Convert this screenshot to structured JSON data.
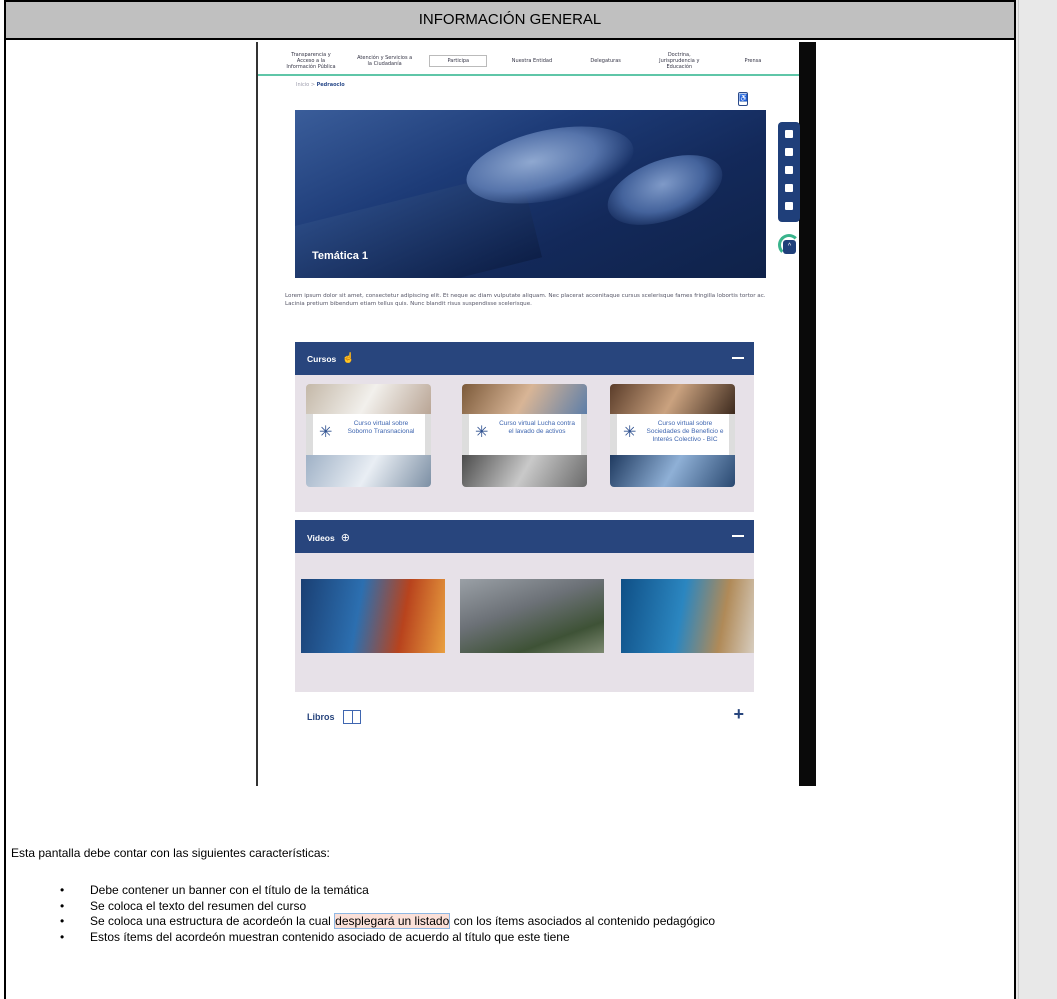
{
  "header": {
    "title": "INFORMACIÓN GENERAL"
  },
  "mockup": {
    "nav": [
      "Transparencia y Acceso a la Información Pública",
      "Atención y Servicios a la Ciudadanía",
      "Participa",
      "Nuestra Entidad",
      "Delegaturas",
      "Doctrina, Jurisprudencia y Educación",
      "Prensa"
    ],
    "breadcrumb": {
      "home": "Inicio",
      "current": "Pedraoclo"
    },
    "banner_title": "Temática 1",
    "summary": "Lorem ipsum dolor sit amet, consectetur adipiscing elit. Et neque ac diam vulputate aliquam. Nec placerat accenitaque cursus scelerisque fames fringilla lobortis tortor ac. Lacinia pretium bibendum etiam tellus quis. Nunc blandit risus suspendisse scelerisque.",
    "accordion": {
      "cursos": {
        "label": "Cursos",
        "items": [
          "Curso virtual sobre Soborno Transnacional",
          "Curso virtual Lucha contra el lavado de activos",
          "Curso virtual sobre Sociedades de Beneficio e Interés Colectivo - BIC"
        ]
      },
      "videos": {
        "label": "Videos"
      },
      "libros": {
        "label": "Libros"
      }
    }
  },
  "description": {
    "intro": "Esta pantalla debe contar con las siguientes características:",
    "bullets": [
      "Debe contener un banner con el título de la temática",
      "Se coloca el texto del resumen del curso",
      {
        "before": "Se coloca una estructura de acordeón la cual ",
        "highlight": "desplegará un listado",
        "after": " con los ítems asociados al contenido pedagógico"
      },
      "Estos ítems del acordeón muestran contenido asociado de acuerdo al título que este tiene"
    ]
  }
}
